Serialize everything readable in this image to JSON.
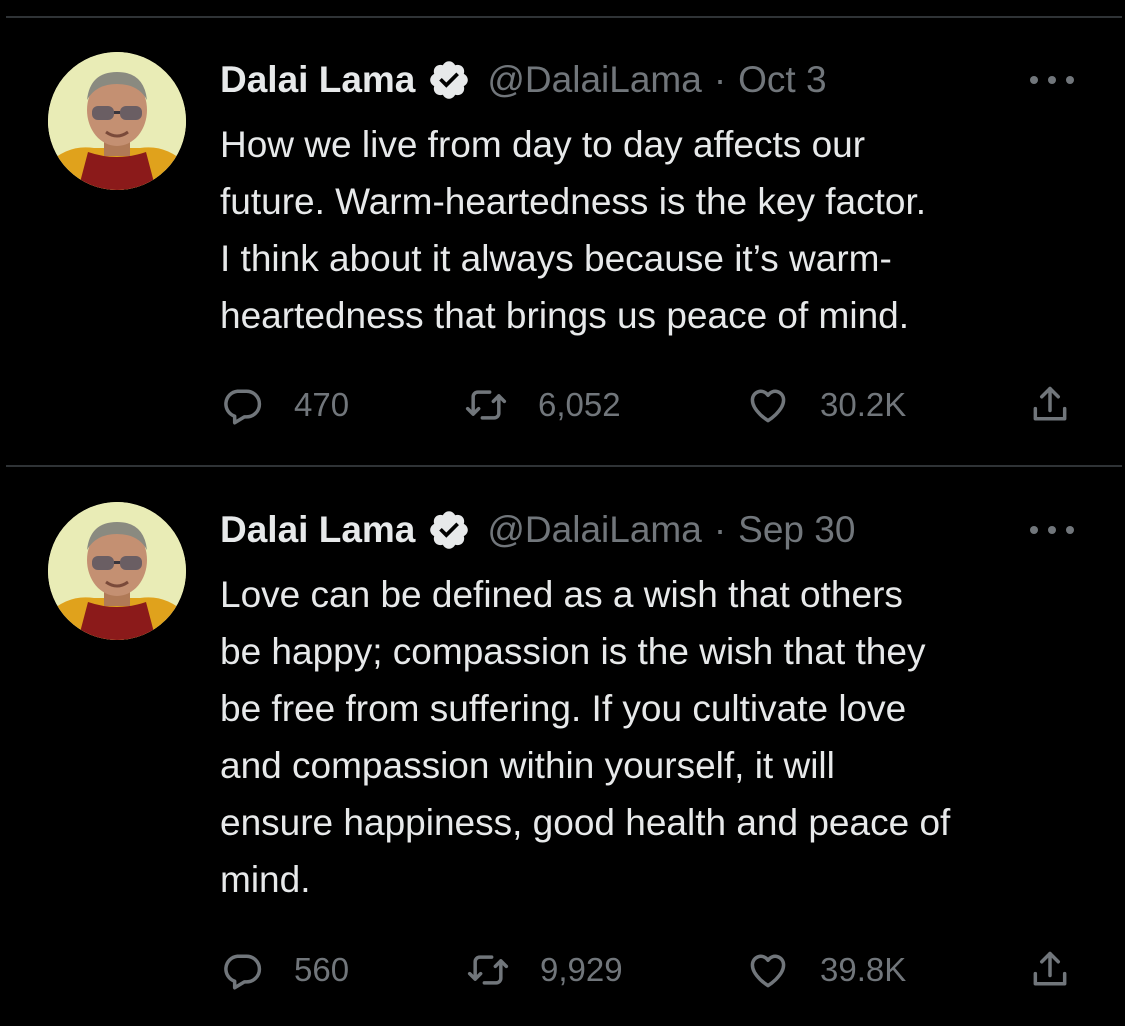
{
  "colors": {
    "background": "#000000",
    "text_primary": "#e7e9ea",
    "text_secondary": "#71767b",
    "divider": "#2f3336"
  },
  "tweets": [
    {
      "display_name": "Dalai Lama",
      "handle": "@DalaiLama",
      "separator": "·",
      "date": "Oct 3",
      "text": "How we live from day to day affects our\nfuture. Warm-heartedness is the key factor.\nI think about it always because it’s warm-\nheartedness that brings us peace of mind.",
      "replies": "470",
      "retweets": "6,052",
      "likes": "30.2K",
      "icons": {
        "verified": "verified-badge-icon",
        "more": "more-icon",
        "reply": "reply-icon",
        "retweet": "retweet-icon",
        "like": "heart-icon",
        "share": "share-icon"
      }
    },
    {
      "display_name": "Dalai Lama",
      "handle": "@DalaiLama",
      "separator": "·",
      "date": "Sep 30",
      "text": "Love can be defined as a wish that others\nbe happy; compassion is the wish that they\nbe free from suffering. If you cultivate love\nand compassion within yourself, it will\nensure happiness, good health and peace of\nmind.",
      "replies": "560",
      "retweets": "9,929",
      "likes": "39.8K",
      "icons": {
        "verified": "verified-badge-icon",
        "more": "more-icon",
        "reply": "reply-icon",
        "retweet": "retweet-icon",
        "like": "heart-icon",
        "share": "share-icon"
      }
    }
  ]
}
